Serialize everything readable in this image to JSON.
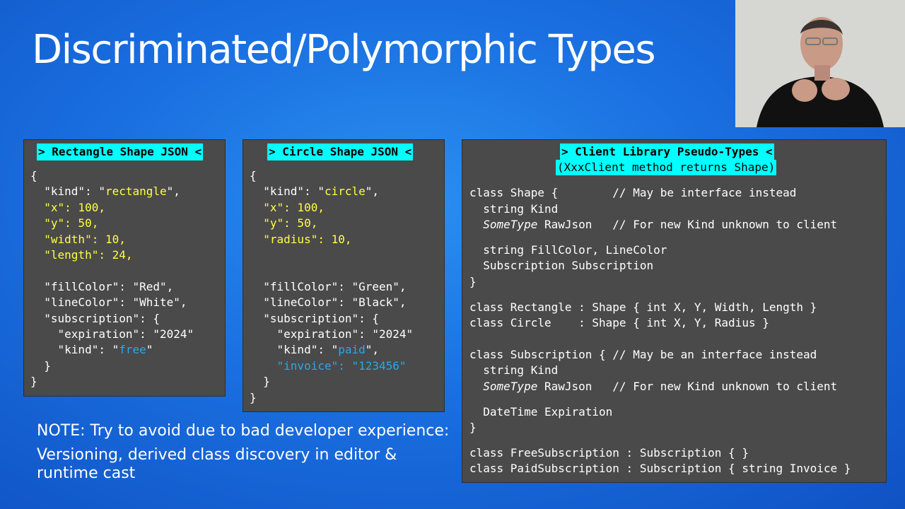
{
  "slide": {
    "title": "Discriminated/Polymorphic Types"
  },
  "rect_panel": {
    "header": "> Rectangle Shape JSON <",
    "lines": [
      [
        [
          "{",
          "w"
        ]
      ],
      [
        [
          "  \"kind\": \"",
          "w"
        ],
        [
          "rectangle",
          "y"
        ],
        [
          "\",",
          "w"
        ]
      ],
      [
        [
          "  \"x\": 100,",
          "y"
        ]
      ],
      [
        [
          "  \"y\": 50,",
          "y"
        ]
      ],
      [
        [
          "  \"width\": 10,",
          "y"
        ]
      ],
      [
        [
          "  \"length\": 24,",
          "y"
        ]
      ],
      [
        [
          "",
          "w"
        ]
      ],
      [
        [
          "  \"fillColor\": \"Red\",",
          "w"
        ]
      ],
      [
        [
          "  \"lineColor\": \"White\",",
          "w"
        ]
      ],
      [
        [
          "  \"subscription\": {",
          "w"
        ]
      ],
      [
        [
          "    \"expiration\": \"2024\"",
          "w"
        ]
      ],
      [
        [
          "    \"kind\": \"",
          "w"
        ],
        [
          "free",
          "b"
        ],
        [
          "\"",
          "w"
        ]
      ],
      [
        [
          "  }",
          "w"
        ]
      ],
      [
        [
          "}",
          "w"
        ]
      ]
    ]
  },
  "circle_panel": {
    "header": "> Circle Shape JSON <",
    "lines": [
      [
        [
          "{",
          "w"
        ]
      ],
      [
        [
          "  \"kind\": \"",
          "w"
        ],
        [
          "circle",
          "y"
        ],
        [
          "\",",
          "w"
        ]
      ],
      [
        [
          "  \"x\": 100,",
          "y"
        ]
      ],
      [
        [
          "  \"y\": 50,",
          "y"
        ]
      ],
      [
        [
          "  \"radius\": 10,",
          "y"
        ]
      ],
      [
        [
          "",
          "w"
        ]
      ],
      [
        [
          "",
          "w"
        ]
      ],
      [
        [
          "  \"fillColor\": \"Green\",",
          "w"
        ]
      ],
      [
        [
          "  \"lineColor\": \"Black\",",
          "w"
        ]
      ],
      [
        [
          "  \"subscription\": {",
          "w"
        ]
      ],
      [
        [
          "    \"expiration\": \"2024\"",
          "w"
        ]
      ],
      [
        [
          "    \"kind\": \"",
          "w"
        ],
        [
          "paid",
          "b"
        ],
        [
          "\",",
          "w"
        ]
      ],
      [
        [
          "    \"invoice\": \"123456\"",
          "b"
        ]
      ],
      [
        [
          "  }",
          "w"
        ]
      ],
      [
        [
          "}",
          "w"
        ]
      ]
    ]
  },
  "client_panel": {
    "header": "> Client Library Pseudo-Types <",
    "subheader": "(XxxClient method returns Shape)",
    "blocks": [
      [
        [
          [
            "class Shape {        // May be interface instead",
            "w"
          ]
        ],
        [
          [
            "  string Kind",
            "w"
          ]
        ],
        [
          [
            "  ",
            "w"
          ],
          [
            "SomeType",
            "w it"
          ],
          [
            " RawJson   // For new Kind unknown to client",
            "w"
          ]
        ]
      ],
      [
        [
          [
            "  string FillColor, LineColor",
            "w"
          ]
        ],
        [
          [
            "  Subscription Subscription",
            "w"
          ]
        ],
        [
          [
            "}",
            "w"
          ]
        ]
      ],
      [
        [
          [
            "class Rectangle : Shape { int X, Y, Width, Length }",
            "w"
          ]
        ],
        [
          [
            "class Circle    : Shape { int X, Y, Radius }",
            "w"
          ]
        ]
      ],
      [
        [
          [
            "class Subscription { // May be an interface instead",
            "w"
          ]
        ],
        [
          [
            "  string Kind",
            "w"
          ]
        ],
        [
          [
            "  ",
            "w"
          ],
          [
            "SomeType",
            "w it"
          ],
          [
            " RawJson   // For new Kind unknown to client",
            "w"
          ]
        ]
      ],
      [
        [
          [
            "  DateTime Expiration",
            "w"
          ]
        ],
        [
          [
            "}",
            "w"
          ]
        ]
      ],
      [
        [
          [
            "class FreeSubscription : Subscription { }",
            "w"
          ]
        ],
        [
          [
            "class PaidSubscription : Subscription { string Invoice }",
            "w"
          ]
        ]
      ]
    ]
  },
  "note": {
    "line1": "NOTE: Try to avoid due to bad developer experience:",
    "line2": "Versioning, derived class discovery in editor &",
    "line3": "runtime cast"
  },
  "colors": {
    "background": "#1a6fe0",
    "panel": "#4a4a4a",
    "header_bg": "#00ffff",
    "value_yellow": "#ffff44",
    "value_blue": "#2ba8e8"
  },
  "icons": {
    "webcam": "presenter-video-feed"
  }
}
